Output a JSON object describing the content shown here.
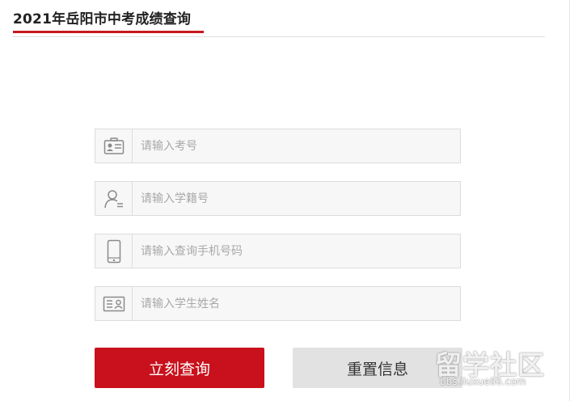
{
  "header": {
    "title": "2021年岳阳市中考成绩查询"
  },
  "form": {
    "fields": [
      {
        "icon": "id-card-icon",
        "placeholder": "请输入考号"
      },
      {
        "icon": "user-icon",
        "placeholder": "请输入学籍号"
      },
      {
        "icon": "mobile-phone-icon",
        "placeholder": "请输入查询手机号码"
      },
      {
        "icon": "name-card-icon",
        "placeholder": "请输入学生姓名"
      }
    ],
    "submit_label": "立刻查询",
    "reset_label": "重置信息"
  },
  "watermark": {
    "logo_text": "留学社区",
    "url": "bbs.liuxue86.com"
  },
  "colors": {
    "accent": "#c8111c",
    "reset_bg": "#e2e2e2",
    "field_bg": "#f7f7f7",
    "border": "#dcdcdc",
    "icon": "#8a8a8a"
  }
}
